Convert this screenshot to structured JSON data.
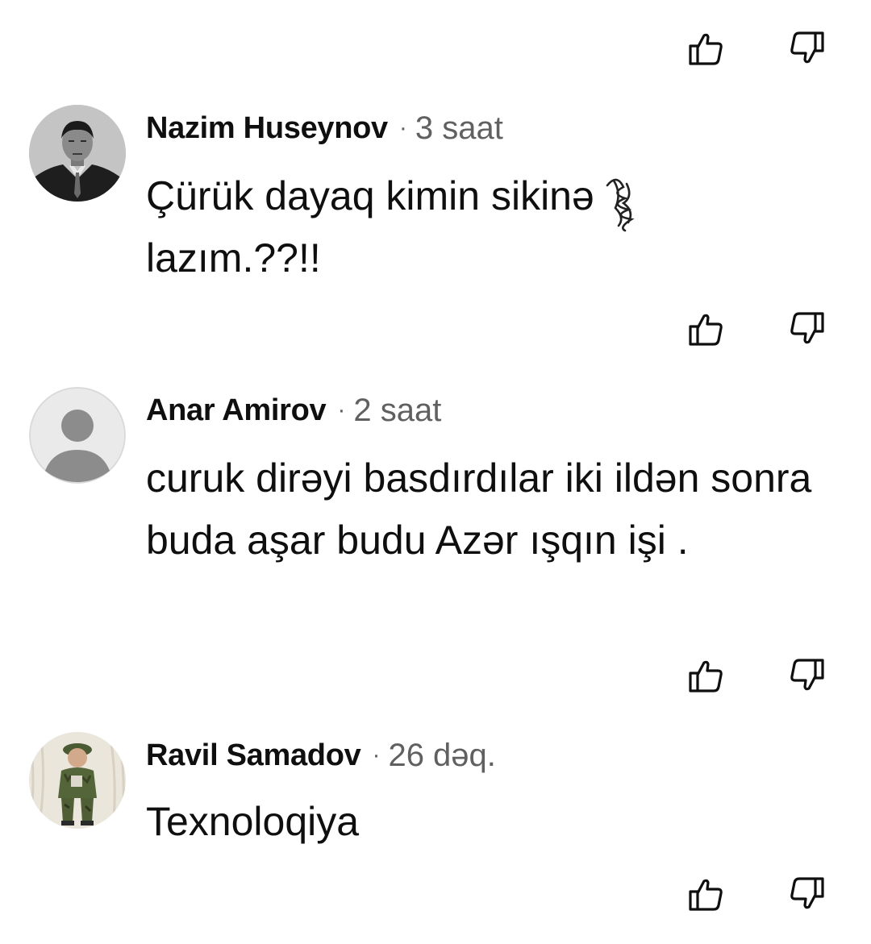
{
  "comments": [
    {
      "author": "Nazim Huseynov",
      "time": "3 saat",
      "text": "Çürük dayaq kimin sikinə lazım.??!!",
      "avatar": "photo-avatar"
    },
    {
      "author": "Anar Amirov",
      "time": "2 saat",
      "text": "curuk dirəyi basdırdılar iki ildən sonra buda aşar budu Azər ışqın işi .",
      "avatar": "default-avatar"
    },
    {
      "author": "Ravil Samadov",
      "time": "26 dəq.",
      "text": "Texnoloqiya",
      "avatar": "photo-avatar"
    }
  ],
  "icons": {
    "like": "thumb-up-icon",
    "dislike": "thumb-down-icon",
    "separator": "·"
  },
  "colors": {
    "text": "#0f0f0f",
    "secondary": "#606060",
    "background": "#ffffff"
  }
}
